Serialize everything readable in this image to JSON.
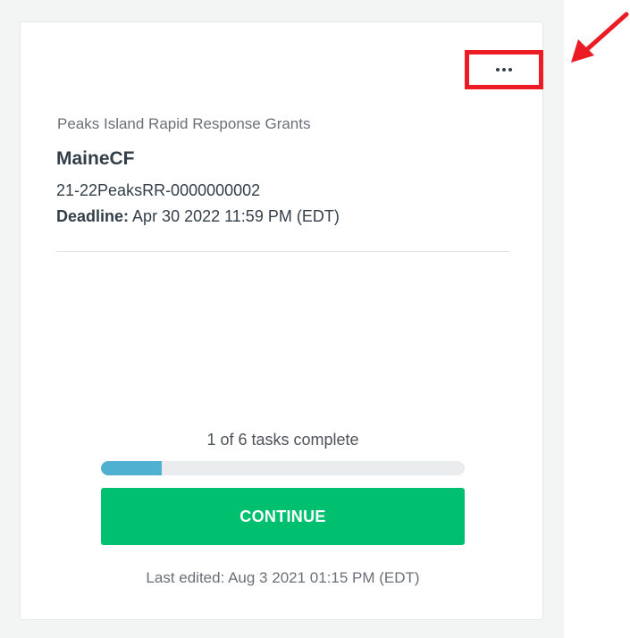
{
  "card": {
    "program_name": "Peaks Island Rapid Response Grants",
    "organization": "MaineCF",
    "application_id": "21-22PeaksRR-0000000002",
    "deadline_label": "Deadline:",
    "deadline_value": "Apr 30 2022 11:59 PM (EDT)",
    "more_menu_icon": "ellipsis-icon"
  },
  "progress": {
    "text": "1 of 6 tasks complete",
    "completed": 1,
    "total": 6
  },
  "actions": {
    "continue_label": "CONTINUE"
  },
  "footer": {
    "last_edited": "Last edited: Aug 3 2021 01:15 PM (EDT)"
  },
  "annotation": {
    "highlight_color": "#ec1c24",
    "arrow_icon": "red-arrow-icon"
  },
  "colors": {
    "accent_green": "#00bf6f",
    "progress_blue": "#4fb0d1",
    "text_dark": "#333e48"
  }
}
